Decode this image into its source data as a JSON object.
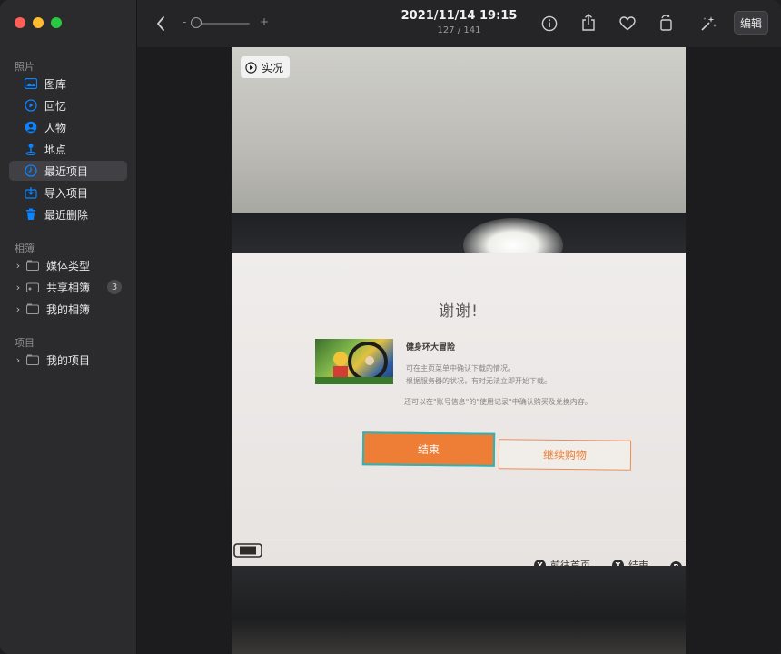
{
  "sidebar": {
    "section_photos": "照片",
    "items": [
      {
        "label": "图库",
        "icon": "photo-library-icon"
      },
      {
        "label": "回忆",
        "icon": "memories-icon"
      },
      {
        "label": "人物",
        "icon": "people-icon"
      },
      {
        "label": "地点",
        "icon": "places-icon"
      },
      {
        "label": "最近项目",
        "icon": "recents-icon",
        "selected": true
      },
      {
        "label": "导入项目",
        "icon": "import-icon"
      },
      {
        "label": "最近删除",
        "icon": "trash-icon"
      }
    ],
    "section_albums": "相簿",
    "albums": [
      {
        "label": "媒体类型"
      },
      {
        "label": "共享相簿",
        "badge": "3"
      },
      {
        "label": "我的相簿"
      }
    ],
    "section_projects": "项目",
    "projects": [
      {
        "label": "我的项目"
      }
    ]
  },
  "toolbar": {
    "date": "2021/11/14 19:15",
    "count": "127 / 141",
    "zoom_minus": "-",
    "zoom_plus": "+",
    "edit_label": "编辑",
    "zoom_level": 0.05
  },
  "photo": {
    "live_label": "实况",
    "screen": {
      "title": "谢谢!",
      "game_name": "健身环大冒险",
      "info_line1": "可在主页菜单中确认下载的情况。",
      "info_line2": "根据服务器的状况，有时无法立即开始下载。",
      "info_line3": "还可以在\"账号信息\"的\"使用记录\"中确认购买及兑换内容。",
      "btn_end": "结束",
      "btn_shop": "继续购物",
      "foot_home_key": "Y",
      "foot_home": "前往首页",
      "foot_end_key": "X",
      "foot_end": "结束",
      "foot_b_key": "B"
    }
  },
  "colors": {
    "accent": "#0a84ff",
    "selected_bg": "#414045",
    "orange": "#ee7e36"
  }
}
